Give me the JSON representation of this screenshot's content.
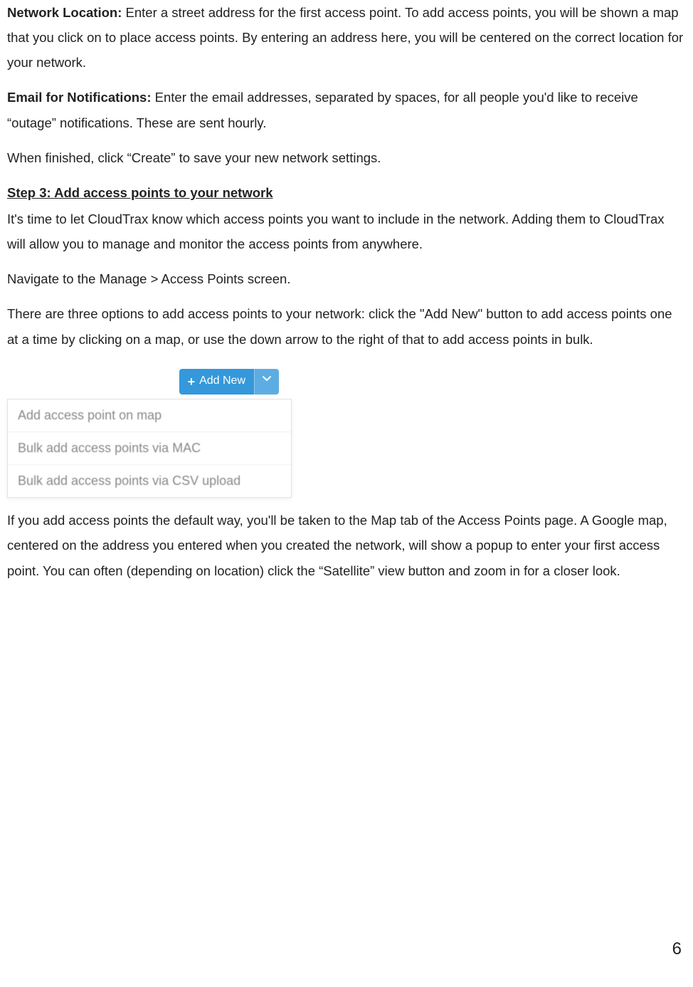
{
  "paragraphs": {
    "net_loc_label": "Network Location:",
    "net_loc_body": " Enter a street address for the first access point. To add access points, you will be shown a map that you click on to place access points. By entering an address here, you will be centered on the correct location for your network.",
    "email_label": "Email for Notifications:",
    "email_body": " Enter the email addresses, separated by spaces, for all people you'd like to receive “outage” notifications. These are sent hourly.",
    "finished": "When finished, click “Create” to save your new network settings.",
    "step3": "Step 3: Add access points to your network",
    "intro_aps": "It's time to let CloudTrax know which access points you want to include in the network. Adding them to CloudTrax will allow you to manage and monitor the access points from anywhere.",
    "navigate": "Navigate to the Manage > Access Points screen.",
    "options": "There are three options to add access points to your network: click the \"Add New\" button to add access points one at a time by clicking on a map, or use the down arrow to the right of that to add access points in bulk.",
    "default_way": "If you add access points the default way, you'll be taken to the Map tab of the Access Points page. A Google map, centered on the address you entered when you created the network, will show a popup to enter your first access point. You can often (depending on location) click the “Satellite” view button and zoom in for a closer look."
  },
  "add_new": {
    "label": "Add New",
    "items": [
      "Add access point on map",
      "Bulk add access points via MAC",
      "Bulk add access points via CSV upload"
    ]
  },
  "page_number": "6"
}
